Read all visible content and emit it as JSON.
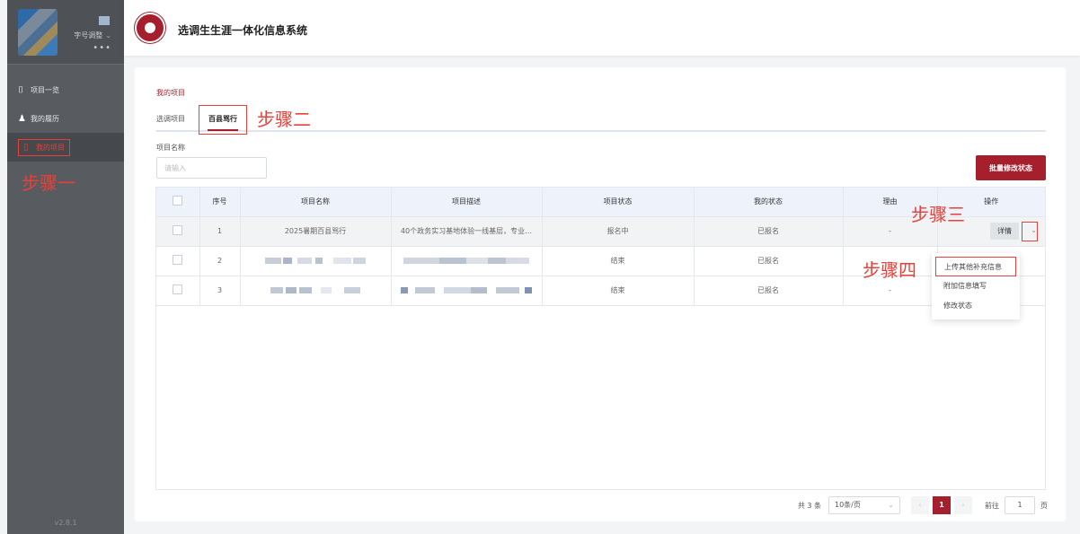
{
  "sidebar": {
    "profile_name": "字号调整",
    "profile_dots": "•••",
    "items": [
      {
        "label": "项目一览",
        "icon": "book-icon"
      },
      {
        "label": "我的履历",
        "icon": "user-icon"
      },
      {
        "label": "我的项目",
        "icon": "document-icon"
      }
    ],
    "version": "v2.8.1"
  },
  "annotations": {
    "step1": "步骤一",
    "step2": "步骤二",
    "step3": "步骤三",
    "step4": "步骤四"
  },
  "header": {
    "title": "选调生生涯一体化信息系统"
  },
  "page": {
    "breadcrumb": "我的项目",
    "tabs": [
      {
        "label": "选调项目"
      },
      {
        "label": "百县骂行"
      }
    ],
    "field_label": "项目名称",
    "search_placeholder": "请输入",
    "batch_button": "批量修改状态"
  },
  "table": {
    "columns": [
      "序号",
      "项目名称",
      "项目描述",
      "项目状态",
      "我的状态",
      "理由",
      "操作"
    ],
    "rows": [
      {
        "no": "1",
        "name": "2025暑期百县骂行",
        "desc": "40个政务实习基地体验一线基层，专业…",
        "status": "报名中",
        "mine": "已报名",
        "reason": "-"
      },
      {
        "no": "2",
        "name": "",
        "desc": "",
        "status": "结束",
        "mine": "已报名",
        "reason": "-"
      },
      {
        "no": "3",
        "name": "",
        "desc": "",
        "status": "结束",
        "mine": "已报名",
        "reason": "-"
      }
    ],
    "detail_label": "详情"
  },
  "menu": {
    "items": [
      "上传其他补充信息",
      "附加信息填写",
      "修改状态"
    ]
  },
  "pager": {
    "total": "共 3 条",
    "page_size": "10条/页",
    "current": "1",
    "goto_label": "前往",
    "goto_value": "1",
    "page_unit": "页"
  },
  "colors": {
    "accent": "#a61f2c",
    "annotation": "#e8413a",
    "sidebar": "#585b60"
  }
}
